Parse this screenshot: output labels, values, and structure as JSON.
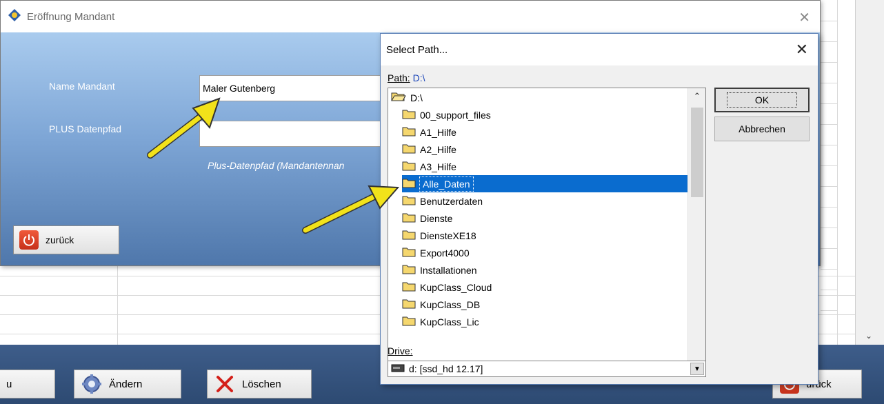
{
  "background": {
    "buttons": [
      {
        "label": "u",
        "icon": "none"
      },
      {
        "label": "Ändern",
        "icon": "gear-icon"
      },
      {
        "label": "Löschen",
        "icon": "x-mark-icon"
      },
      {
        "label": "urück",
        "icon": "power-icon"
      }
    ]
  },
  "mandant_dialog": {
    "title": "Eröffnung Mandant",
    "name_label": "Name Mandant",
    "name_value": "Maler Gutenberg",
    "path_label": "PLUS Datenpfad",
    "path_value": "",
    "hint": "Plus-Datenpfad (Mandantennan",
    "back_button": "zurück"
  },
  "select_path": {
    "title": "Select Path...",
    "path_label": "Path:",
    "path_value": "D:\\",
    "root": "D:\\",
    "folders": [
      "00_support_files",
      "A1_Hilfe",
      "A2_Hilfe",
      "A3_Hilfe",
      "Alle_Daten",
      "Benutzerdaten",
      "Dienste",
      "DiensteXE18",
      "Export4000",
      "Installationen",
      "KupClass_Cloud",
      "KupClass_DB",
      "KupClass_Lic"
    ],
    "selected_folder": "Alle_Daten",
    "ok_label": "OK",
    "cancel_label": "Abbrechen",
    "drive_label": "Drive:",
    "drive_value": "d: [ssd_hd 12.17]"
  },
  "colors": {
    "selection": "#0a6ccf",
    "arrow": "#f2e21a",
    "link_blue": "#1a44b8"
  }
}
